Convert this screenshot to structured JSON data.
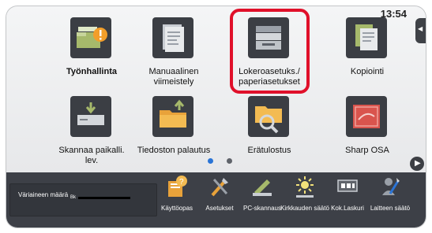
{
  "clock": "13:54",
  "side_tab": {
    "icon": "left-arrow-icon"
  },
  "home_tiles": [
    {
      "label": "Työnhallinta",
      "icon": "job-status-icon"
    },
    {
      "label": "Manuaalinen viimeistely",
      "icon": "manual-finishing-icon"
    },
    {
      "label": "Lokeroasetuks./ paperiasetukset",
      "icon": "tray-settings-icon",
      "highlighted": true
    },
    {
      "label": "Kopiointi",
      "icon": "copy-icon"
    },
    {
      "label": "Skannaa paikalli. lev.",
      "icon": "scan-to-local-drive-icon"
    },
    {
      "label": "Tiedoston palautus",
      "icon": "file-retrieve-icon"
    },
    {
      "label": "Erätulostus",
      "icon": "batch-print-icon"
    },
    {
      "label": "Sharp OSA",
      "icon": "sharp-osa-icon"
    }
  ],
  "pagination": {
    "current": 1,
    "total": 2
  },
  "toner": {
    "label": "Väriaineen määrä",
    "color_label": "Bk",
    "level": 1.0
  },
  "bottom_buttons": [
    {
      "label": "Käyttöopas",
      "icon": "user-guide-icon"
    },
    {
      "label": "Asetukset",
      "icon": "settings-icon"
    },
    {
      "label": "PC-skannaus",
      "icon": "pc-scan-icon"
    },
    {
      "label": "Kirkkauden säätö",
      "icon": "brightness-icon"
    },
    {
      "label": "Kok.Laskuri",
      "icon": "total-count-icon"
    },
    {
      "label": "Laitteen säätö",
      "icon": "machine-adjust-icon"
    }
  ],
  "colors": {
    "highlight": "#e0102a",
    "bottom_bar": "#3d4047",
    "tile_icon_dark": "#3b3e44",
    "accent_blue": "#2a74d6"
  }
}
